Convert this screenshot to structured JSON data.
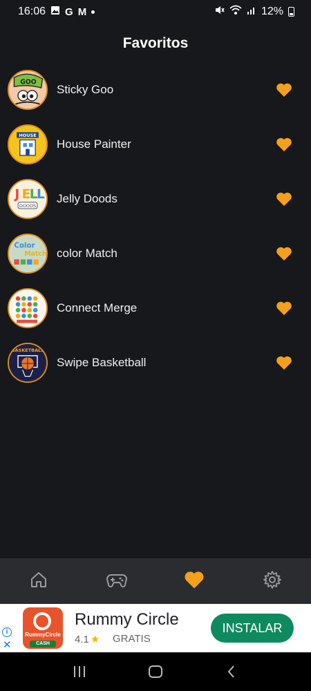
{
  "status_bar": {
    "time": "16:06",
    "notification_icons": [
      "image-icon",
      "google-icon",
      "gmail-icon",
      "dot-icon"
    ],
    "system_icons": [
      "mute-icon",
      "wifi-icon",
      "signal-icon",
      "battery-icon"
    ],
    "battery": "12%"
  },
  "header": {
    "title": "Favoritos"
  },
  "favorites": [
    {
      "name": "Sticky Goo",
      "icon": "sticky-goo-thumbnail"
    },
    {
      "name": "House Painter",
      "icon": "house-painter-thumbnail"
    },
    {
      "name": "Jelly Doods",
      "icon": "jelly-doods-thumbnail"
    },
    {
      "name": "color Match",
      "icon": "color-match-thumbnail"
    },
    {
      "name": "Connect Merge",
      "icon": "connect-merge-thumbnail"
    },
    {
      "name": "Swipe Basketball",
      "icon": "swipe-basketball-thumbnail"
    }
  ],
  "bottom_nav": {
    "tabs": [
      {
        "icon": "home-icon",
        "active": false
      },
      {
        "icon": "gamepad-icon",
        "active": false
      },
      {
        "icon": "heart-icon",
        "active": true
      },
      {
        "icon": "gear-icon",
        "active": false
      }
    ]
  },
  "ad": {
    "app_name": "Rummy Circle",
    "rating": "4.1",
    "price": "GRATIS",
    "install_label": "INSTALAR",
    "logo_text": "RummyCircle",
    "logo_badge": "CASH"
  },
  "colors": {
    "background": "#16181b",
    "accent": "#f5a01a",
    "nav_bar": "#2a2c30",
    "install_button": "#0f8a5f"
  }
}
